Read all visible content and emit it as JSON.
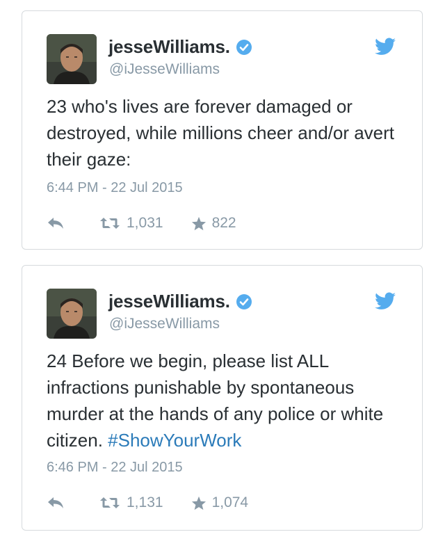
{
  "tweets": [
    {
      "display_name": "jesseWilliams.",
      "handle": "@iJesseWilliams",
      "text": "23 who's lives are forever damaged or destroyed, while millions cheer and/or avert their gaze:",
      "hashtag": "",
      "timestamp": "6:44 PM - 22 Jul 2015",
      "retweets": "1,031",
      "favorites": "822",
      "icons": {
        "reply": "reply-icon",
        "retweet": "retweet-icon",
        "favorite": "star-icon",
        "verified": "verified-badge-icon",
        "brand": "twitter-bird-icon"
      }
    },
    {
      "display_name": "jesseWilliams.",
      "handle": "@iJesseWilliams",
      "text": "24 Before we begin, please list ALL infractions punishable by spontaneous murder at the hands of any police or white citizen. ",
      "hashtag": "#ShowYourWork",
      "timestamp": "6:46 PM - 22 Jul 2015",
      "retweets": "1,131",
      "favorites": "1,074",
      "icons": {
        "reply": "reply-icon",
        "retweet": "retweet-icon",
        "favorite": "star-icon",
        "verified": "verified-badge-icon",
        "brand": "twitter-bird-icon"
      }
    }
  ],
  "colors": {
    "text": "#292f33",
    "muted": "#8899a6",
    "link": "#2b7bb9",
    "brand": "#55acee",
    "border": "#d6dadd"
  }
}
